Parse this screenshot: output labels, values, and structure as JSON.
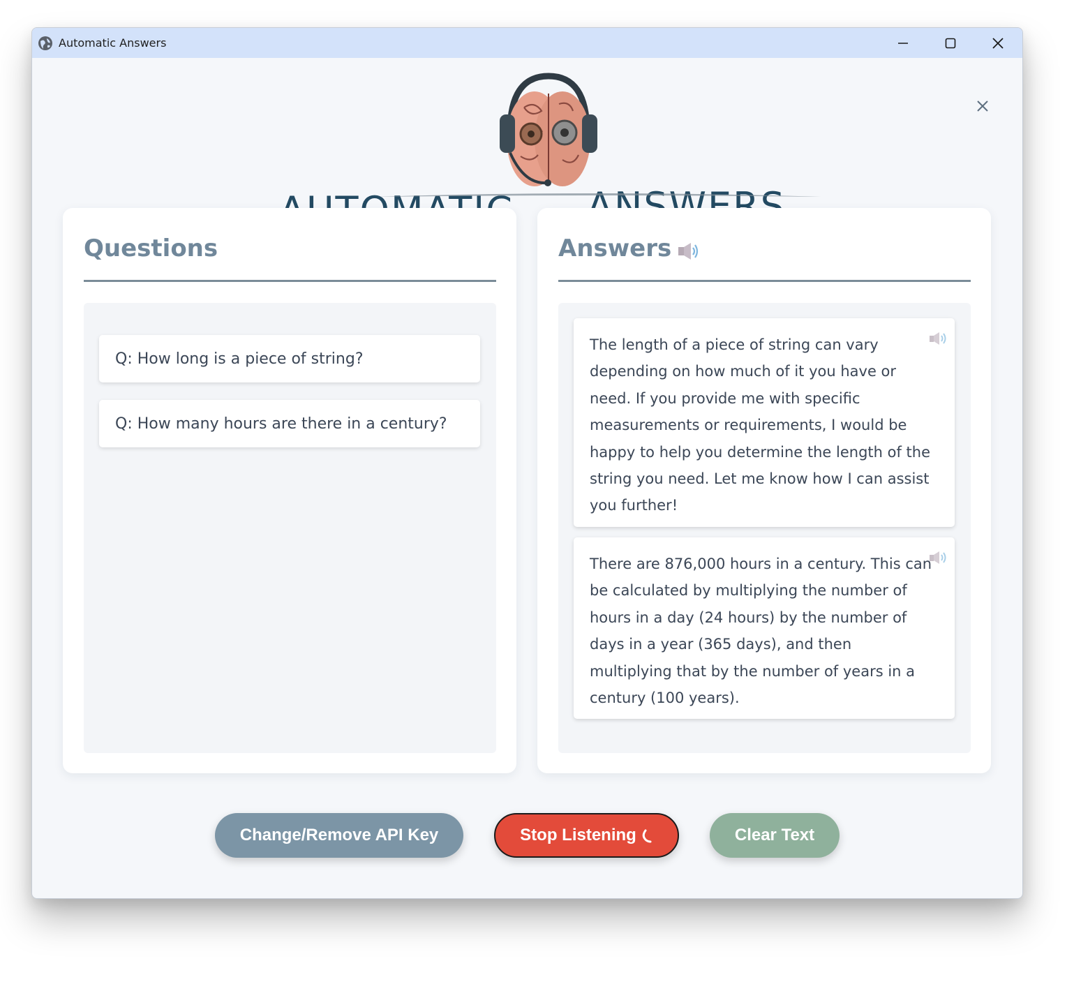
{
  "window": {
    "title": "Automatic Answers",
    "icon": "globe-icon",
    "controls": [
      "minimize-icon",
      "maximize-icon",
      "close-icon"
    ]
  },
  "logo": {
    "left_word": "AUTOMATIC",
    "right_word": "ANSWERS",
    "emblem": "brain-headphones-icon"
  },
  "questions_panel": {
    "title": "Questions",
    "items": [
      "Q: How long is a piece of string?",
      "Q: How many hours are there in a century?"
    ]
  },
  "answers_panel": {
    "title": "Answers",
    "speaker_icon": "speaker-icon",
    "items": [
      "The length of a piece of string can vary depending on how much of it you have or need. If you provide me with specific measurements or requirements, I would be happy to help you determine the length of the string you need. Let me know how I can assist you further!",
      "There are 876,000 hours in a century. This can be calculated by multiplying the number of hours in a day (24 hours) by the number of days in a year (365 days), and then multiplying that by the number of years in a century (100 years)."
    ]
  },
  "buttons": {
    "api_key": "Change/Remove API Key",
    "stop_listening": "Stop Listening",
    "clear_text": "Clear Text"
  },
  "colors": {
    "titlebar": "#d3e2fa",
    "api_button": "#7c95a6",
    "stop_button": "#e34b3a",
    "clear_button": "#8fb19c",
    "heading": "#70879a",
    "logo_text": "#234a62"
  }
}
